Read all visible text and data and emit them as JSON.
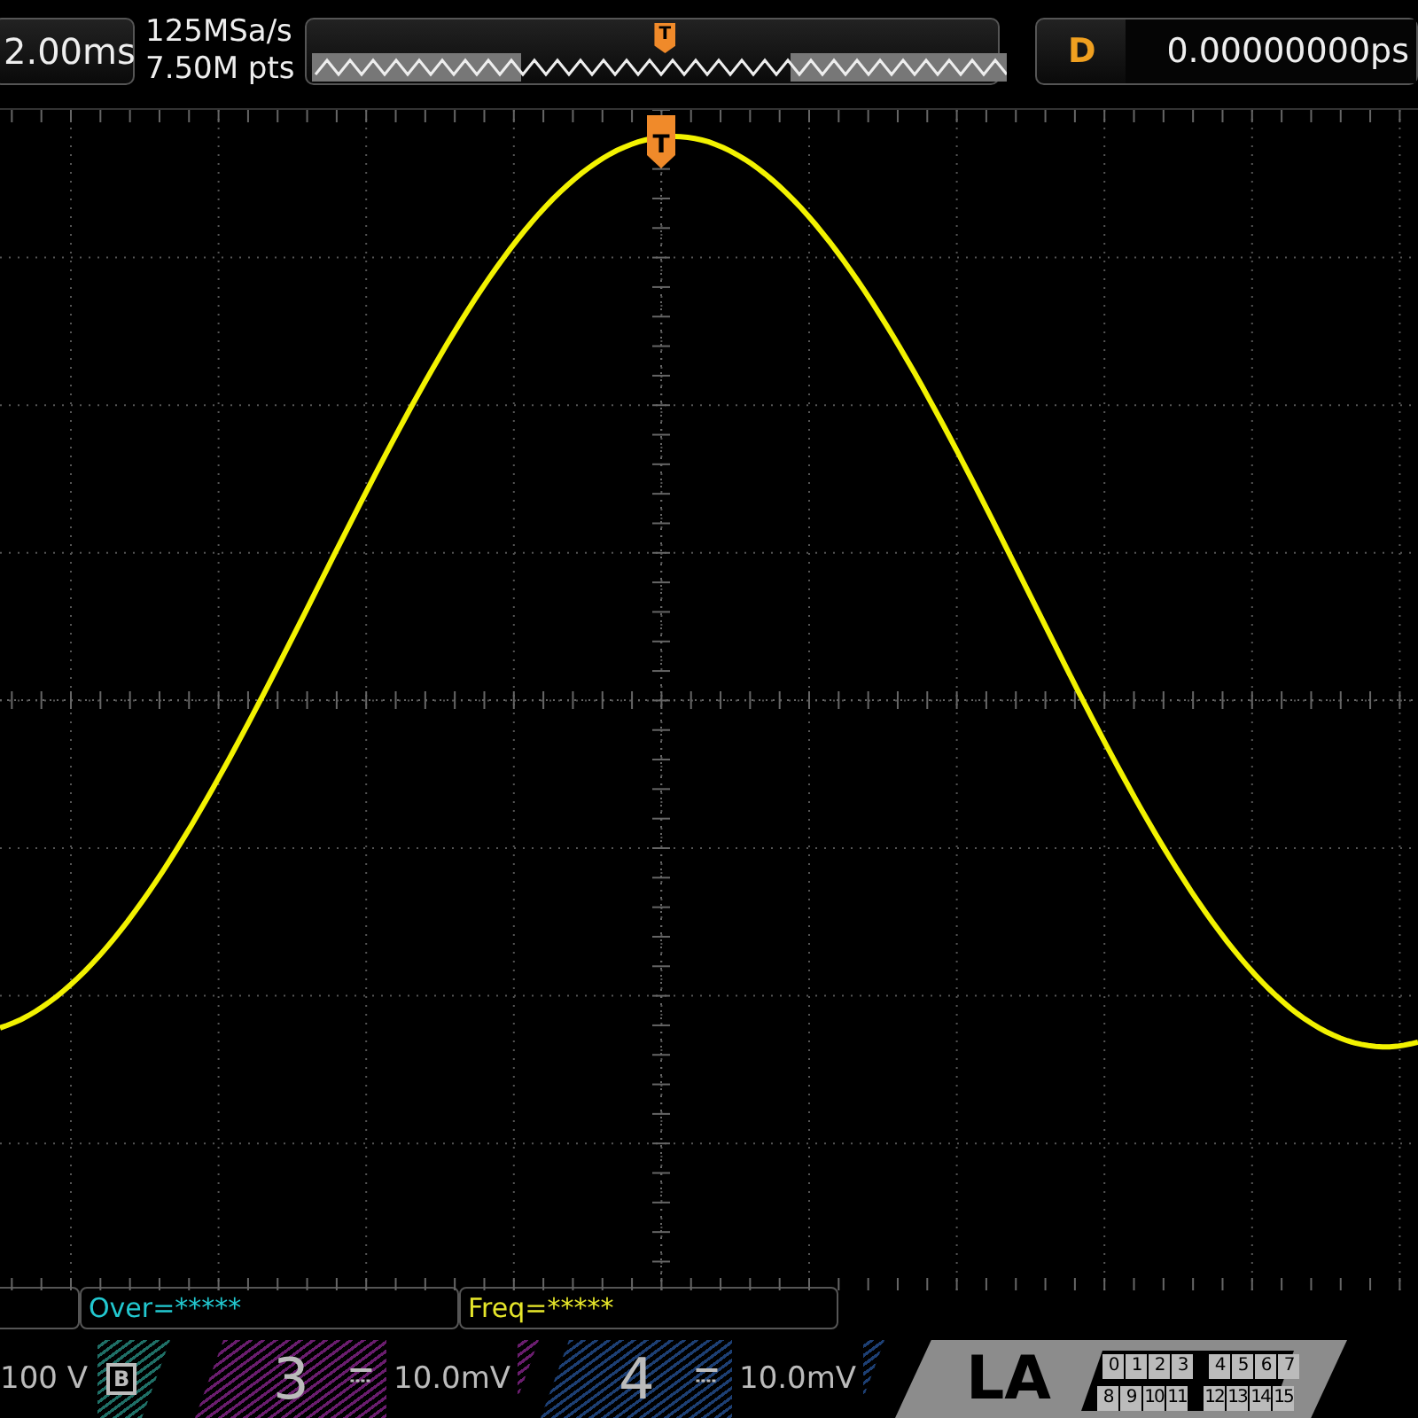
{
  "top_bar": {
    "timebase": "2.00ms",
    "sample_rate": "125MSa/s",
    "memory_depth": "7.50M pts",
    "memory_trigger_marker": "T",
    "delay_label": "D",
    "delay_value": "0.00000000ps"
  },
  "trigger_marker": "T",
  "measurements": [
    {
      "text": "Over=*****",
      "color": "#22c8d0"
    },
    {
      "text": "Freq=*****",
      "color": "#e6e62a"
    }
  ],
  "channels": [
    {
      "kind": "analog",
      "scale": "100 V",
      "badge": "B",
      "color": "#1f6f66"
    },
    {
      "kind": "analog",
      "number": "3",
      "scale": "10.0mV",
      "color": "#6a1d6e"
    },
    {
      "kind": "analog",
      "number": "4",
      "scale": "10.0mV",
      "color": "#1d3f73"
    }
  ],
  "logic": {
    "label": "LA",
    "rows": [
      [
        "0",
        "1",
        "2",
        "3",
        "4",
        "5",
        "6",
        "7"
      ],
      [
        "8",
        "9",
        "10",
        "11",
        "12",
        "13",
        "14",
        "15"
      ]
    ]
  }
}
